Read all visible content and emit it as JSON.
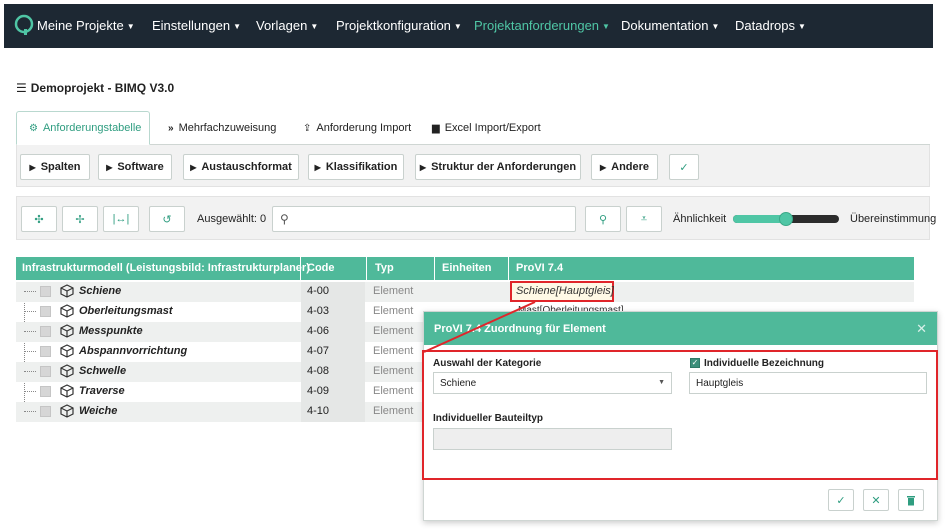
{
  "nav": {
    "items": [
      {
        "label": "Meine Projekte"
      },
      {
        "label": "Einstellungen"
      },
      {
        "label": "Vorlagen"
      },
      {
        "label": "Projektkonfiguration"
      },
      {
        "label": "Projektanforderungen"
      },
      {
        "label": "Dokumentation"
      },
      {
        "label": "Datadrops"
      }
    ],
    "active_color": "#4fc6a5",
    "background": "#1d2833"
  },
  "project": {
    "title": "Demoprojekt - BIMQ V3.0"
  },
  "tabs": [
    {
      "label": "Anforderungstabelle",
      "icon": "cogs-icon"
    },
    {
      "label": "Mehrfachzuweisung",
      "icon": "double-chevron-icon"
    },
    {
      "label": "Anforderung Import",
      "icon": "upload-icon"
    },
    {
      "label": "Excel Import/Export",
      "icon": "file-icon"
    }
  ],
  "toolbar1": {
    "buttons": [
      "Spalten",
      "Software",
      "Austauschformat",
      "Klassifikation",
      "Struktur der Anforderungen",
      "Andere"
    ]
  },
  "toolbar2": {
    "selected_label": "Ausgewählt: 0",
    "search_value": "",
    "similarity_label": "Ähnlichkeit",
    "match_label": "Übereinstimmung",
    "slider_value": 0.5
  },
  "table": {
    "headers": [
      "Infrastrukturmodell (Leistungsbild: Infrastrukturplaner)",
      "Code",
      "Typ",
      "Einheiten",
      "ProVI 7.4"
    ],
    "rows": [
      {
        "name": "Schiene",
        "code": "4-00",
        "typ": "Element"
      },
      {
        "name": "Oberleitungsmast",
        "code": "4-03",
        "typ": "Element"
      },
      {
        "name": "Messpunkte",
        "code": "4-06",
        "typ": "Element"
      },
      {
        "name": "Abspannvorrichtung",
        "code": "4-07",
        "typ": "Element"
      },
      {
        "name": "Schwelle",
        "code": "4-08",
        "typ": "Element"
      },
      {
        "name": "Traverse",
        "code": "4-09",
        "typ": "Element"
      },
      {
        "name": "Weiche",
        "code": "4-10",
        "typ": "Element"
      }
    ],
    "provi_first": "Schiene[Hauptgleis]",
    "provi_second": "Mast[Oberleitungsmast]"
  },
  "modal": {
    "title": "ProVI 7.4 Zuordnung für Element",
    "category_label": "Auswahl der Kategorie",
    "category_value": "Schiene",
    "individual_label": "Individuelle Bezeichnung",
    "individual_value": "Hauptgleis",
    "bauteiltyp_label": "Individueller Bauteiltyp",
    "bauteiltyp_value": ""
  },
  "accent": "#4fb99a",
  "highlight": "#e0252a"
}
